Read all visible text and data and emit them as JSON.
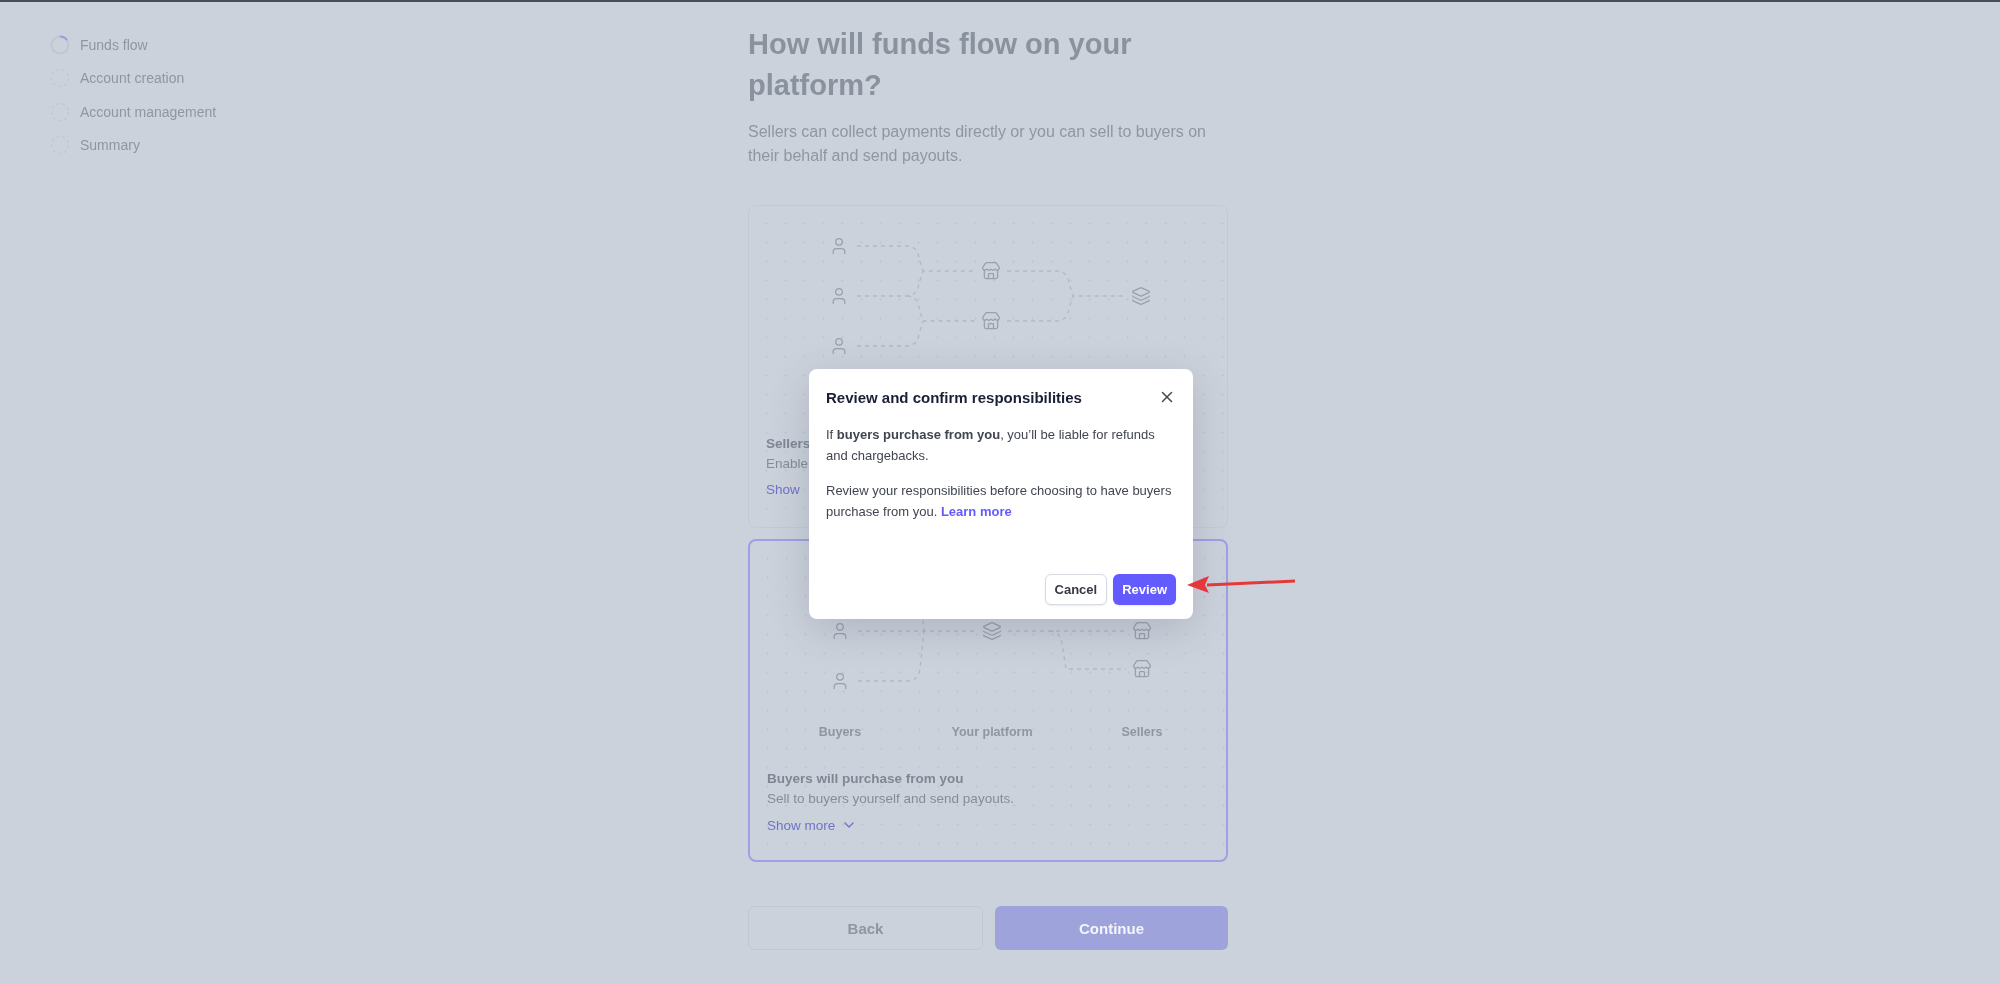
{
  "steps": [
    {
      "label": "Funds flow",
      "kind": "in_progress"
    },
    {
      "label": "Account creation",
      "kind": "pending"
    },
    {
      "label": "Account management",
      "kind": "pending"
    },
    {
      "label": "Summary",
      "kind": "pending"
    }
  ],
  "heading": "How will funds flow on your platform?",
  "subtitle": "Sellers can collect payments directly or you can sell to buyers on their behalf and send payouts.",
  "options": [
    {
      "kind": "sellers_collect",
      "selected": false,
      "title": "Sellers",
      "description": "Enable",
      "link": "Show"
    },
    {
      "kind": "buyers_purchase",
      "selected": true,
      "node_labels": [
        "Buyers",
        "Your platform",
        "Sellers"
      ],
      "title": "Buyers will purchase from you",
      "description": "Sell to buyers yourself and send payouts.",
      "link": "Show more"
    }
  ],
  "footer_buttons": [
    {
      "label": "Back",
      "kind": "secondary"
    },
    {
      "label": "Continue",
      "kind": "primary"
    }
  ],
  "dialog": {
    "title": "Review and confirm responsibilities",
    "paragraphs": [
      "If **buyers purchase from you**, you’ll be liable for refunds and chargebacks.",
      "Review your responsibilities before choosing to have buyers purchase from you."
    ],
    "link": "Learn more",
    "buttons": [
      {
        "label": "Cancel",
        "kind": "secondary"
      },
      {
        "label": "Review",
        "kind": "primary"
      }
    ]
  }
}
